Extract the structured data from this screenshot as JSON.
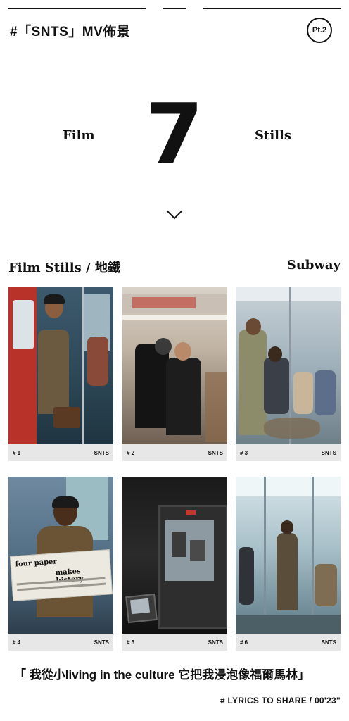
{
  "header": {
    "title": "#「SNTS」MV佈景",
    "badge": "Pt.2"
  },
  "hero": {
    "left": "Film",
    "number": "7",
    "right": "Stills"
  },
  "section": {
    "title": "Film Stills / 地鐵",
    "right": "Subway"
  },
  "cards": [
    {
      "index": "# 1",
      "brand": "SNTS"
    },
    {
      "index": "# 2",
      "brand": "SNTS"
    },
    {
      "index": "# 3",
      "brand": "SNTS"
    },
    {
      "index": "# 4",
      "brand": "SNTS"
    },
    {
      "index": "# 5",
      "brand": "SNTS"
    },
    {
      "index": "# 6",
      "brand": "SNTS"
    }
  ],
  "newspaper": {
    "headline1": "four paper",
    "headline2": "makes history"
  },
  "lyrics": {
    "quote": "「 我從小living in the culture 它把我浸泡像福爾馬林」",
    "credit": "# LYRICS TO SHARE / 00'23\""
  }
}
